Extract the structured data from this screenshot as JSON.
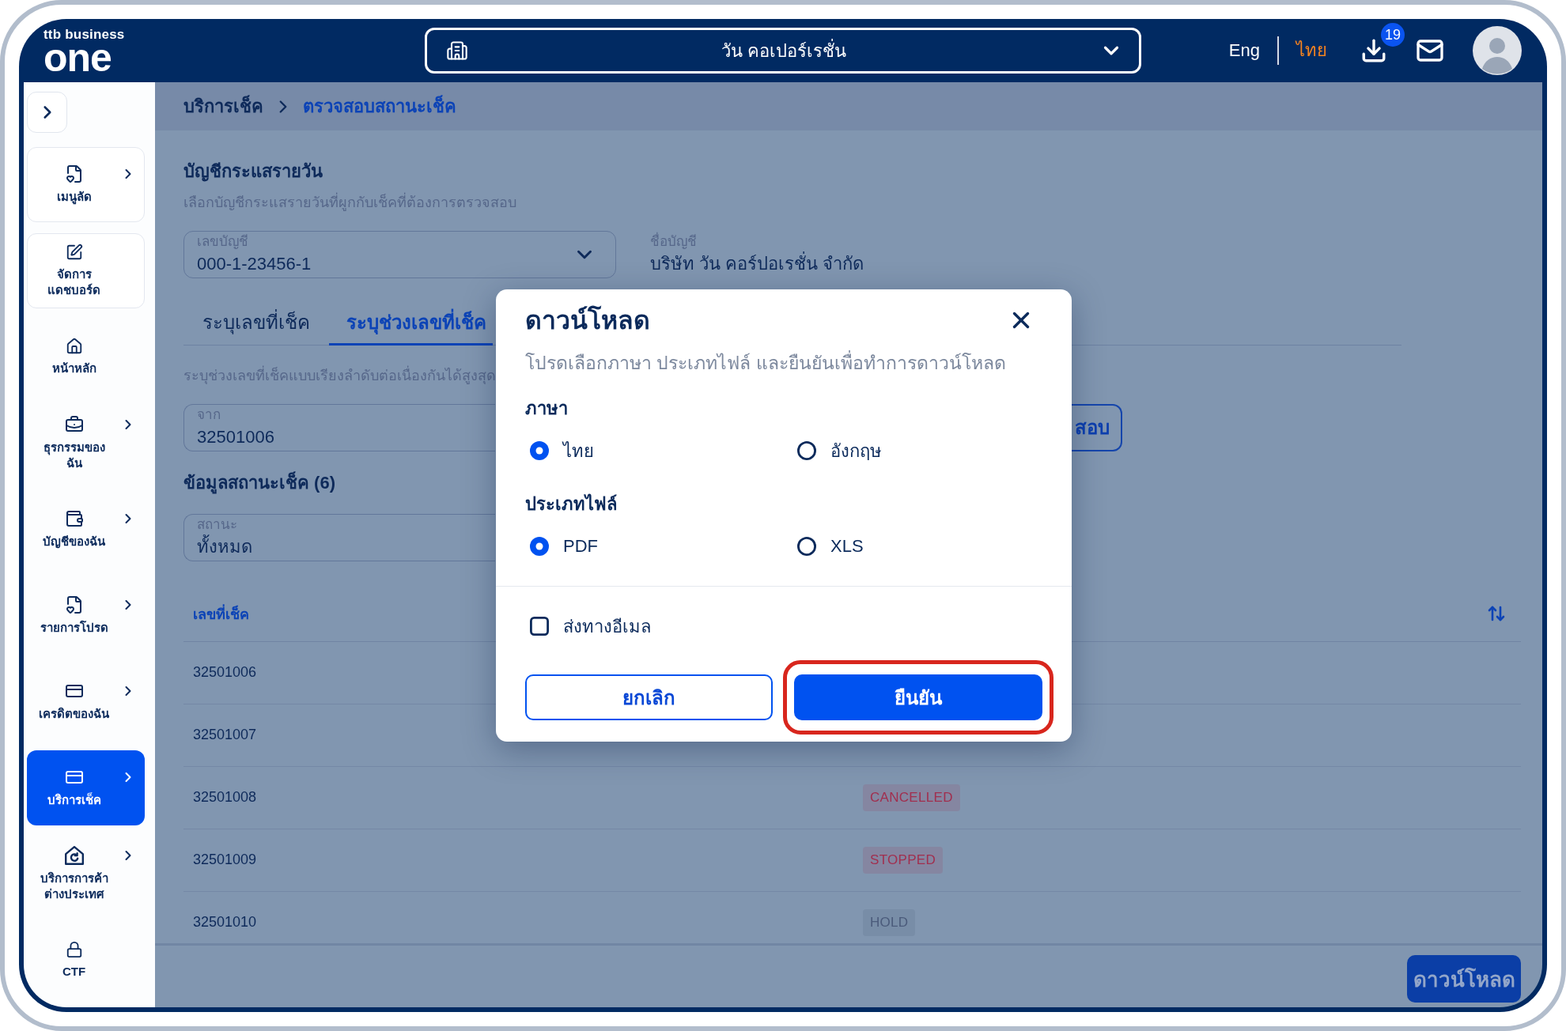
{
  "header": {
    "logo": {
      "tagline": "ttb business",
      "wordmark": "one"
    },
    "company": "วัน คอเปอร์เรชั่น",
    "languages": [
      {
        "label": "Eng",
        "selected": false
      },
      {
        "label": "ไทย",
        "selected": true
      }
    ],
    "download_count": "19"
  },
  "sidebar": {
    "items": [
      {
        "label": "เมนูลัด",
        "kind": "card",
        "has_submenu": true,
        "selected": false
      },
      {
        "label": "จัดการ\nแดชบอร์ด",
        "kind": "card",
        "has_submenu": false,
        "selected": false
      },
      {
        "label": "หน้าหลัก",
        "kind": "plain",
        "has_submenu": false,
        "selected": false
      },
      {
        "label": "ธุรกรรมของ\nฉัน",
        "kind": "plain",
        "has_submenu": true,
        "selected": false
      },
      {
        "label": "บัญชีของฉัน",
        "kind": "plain",
        "has_submenu": true,
        "selected": false
      },
      {
        "label": "รายการโปรด",
        "kind": "plain",
        "has_submenu": true,
        "selected": false
      },
      {
        "label": "เครดิตของฉัน",
        "kind": "plain",
        "has_submenu": true,
        "selected": false
      },
      {
        "label": "บริการเช็ค",
        "kind": "plain",
        "has_submenu": true,
        "selected": true
      },
      {
        "label": "บริการการค้า\nต่างประเทศ",
        "kind": "plain",
        "has_submenu": true,
        "selected": false
      },
      {
        "label": "CTF",
        "kind": "plain",
        "has_submenu": false,
        "selected": false
      }
    ]
  },
  "breadcrumb": [
    {
      "label": "บริการเช็ค",
      "current": false
    },
    {
      "label": "ตรวจสอบสถานะเช็ค",
      "current": true
    }
  ],
  "account": {
    "title": "บัญชีกระแสรายวัน",
    "description": "เลือกบัญชีกระแสรายวันที่ผูกกับเช็คที่ต้องการตรวจสอบ",
    "number_field": {
      "label": "เลขบัญชี",
      "value": "000-1-23456-1"
    },
    "name_field": {
      "label": "ชื่อบัญชี",
      "value": "บริษัท วัน คอร์ปอเรชั่น จำกัด"
    }
  },
  "tabs": [
    {
      "label": "ระบุเลขที่เช็ค",
      "selected": false
    },
    {
      "label": "ระบุช่วงเลขที่เช็ค",
      "selected": true
    }
  ],
  "range": {
    "hint": "ระบุช่วงเลขที่เช็คแบบเรียงลำดับต่อเนื่องกันได้สูงสุด",
    "from_field": {
      "label": "จาก",
      "value": "32501006"
    },
    "verify_button": "สอบ"
  },
  "status": {
    "title": "ข้อมูลสถานะเช็ค (6)",
    "filter_field": {
      "label": "สถานะ",
      "value": "ทั้งหมด"
    }
  },
  "table": {
    "columns": [
      "เลขที่เช็ค"
    ],
    "rows": [
      {
        "check_number": "32501006"
      },
      {
        "check_number": "32501007"
      },
      {
        "check_number": "32501008",
        "status": "CANCELLED",
        "color": "#a12f4f"
      },
      {
        "check_number": "32501009",
        "status": "STOPPED",
        "color": "#a12f4f"
      },
      {
        "check_number": "32501010",
        "status": "HOLD",
        "color": "#4b5b7b"
      }
    ]
  },
  "footer": {
    "download_button": "ดาวน์โหลด"
  },
  "modal": {
    "title": "ดาวน์โหลด",
    "description": "โปรดเลือกภาษา ประเภทไฟล์ และยืนยันเพื่อทำการดาวน์โหลด",
    "groups": [
      {
        "label": "ภาษา",
        "options": [
          {
            "label": "ไทย",
            "selected": true
          },
          {
            "label": "อังกฤษ",
            "selected": false
          }
        ]
      },
      {
        "label": "ประเภทไฟล์",
        "options": [
          {
            "label": "PDF",
            "selected": true
          },
          {
            "label": "XLS",
            "selected": false
          }
        ]
      }
    ],
    "email_option": {
      "label": "ส่งทางอีเมล",
      "checked": false
    },
    "buttons": [
      {
        "label": "ยกเลิก",
        "kind": "secondary",
        "highlighted": false
      },
      {
        "label": "ยืนยัน",
        "kind": "primary",
        "highlighted": true
      }
    ]
  }
}
